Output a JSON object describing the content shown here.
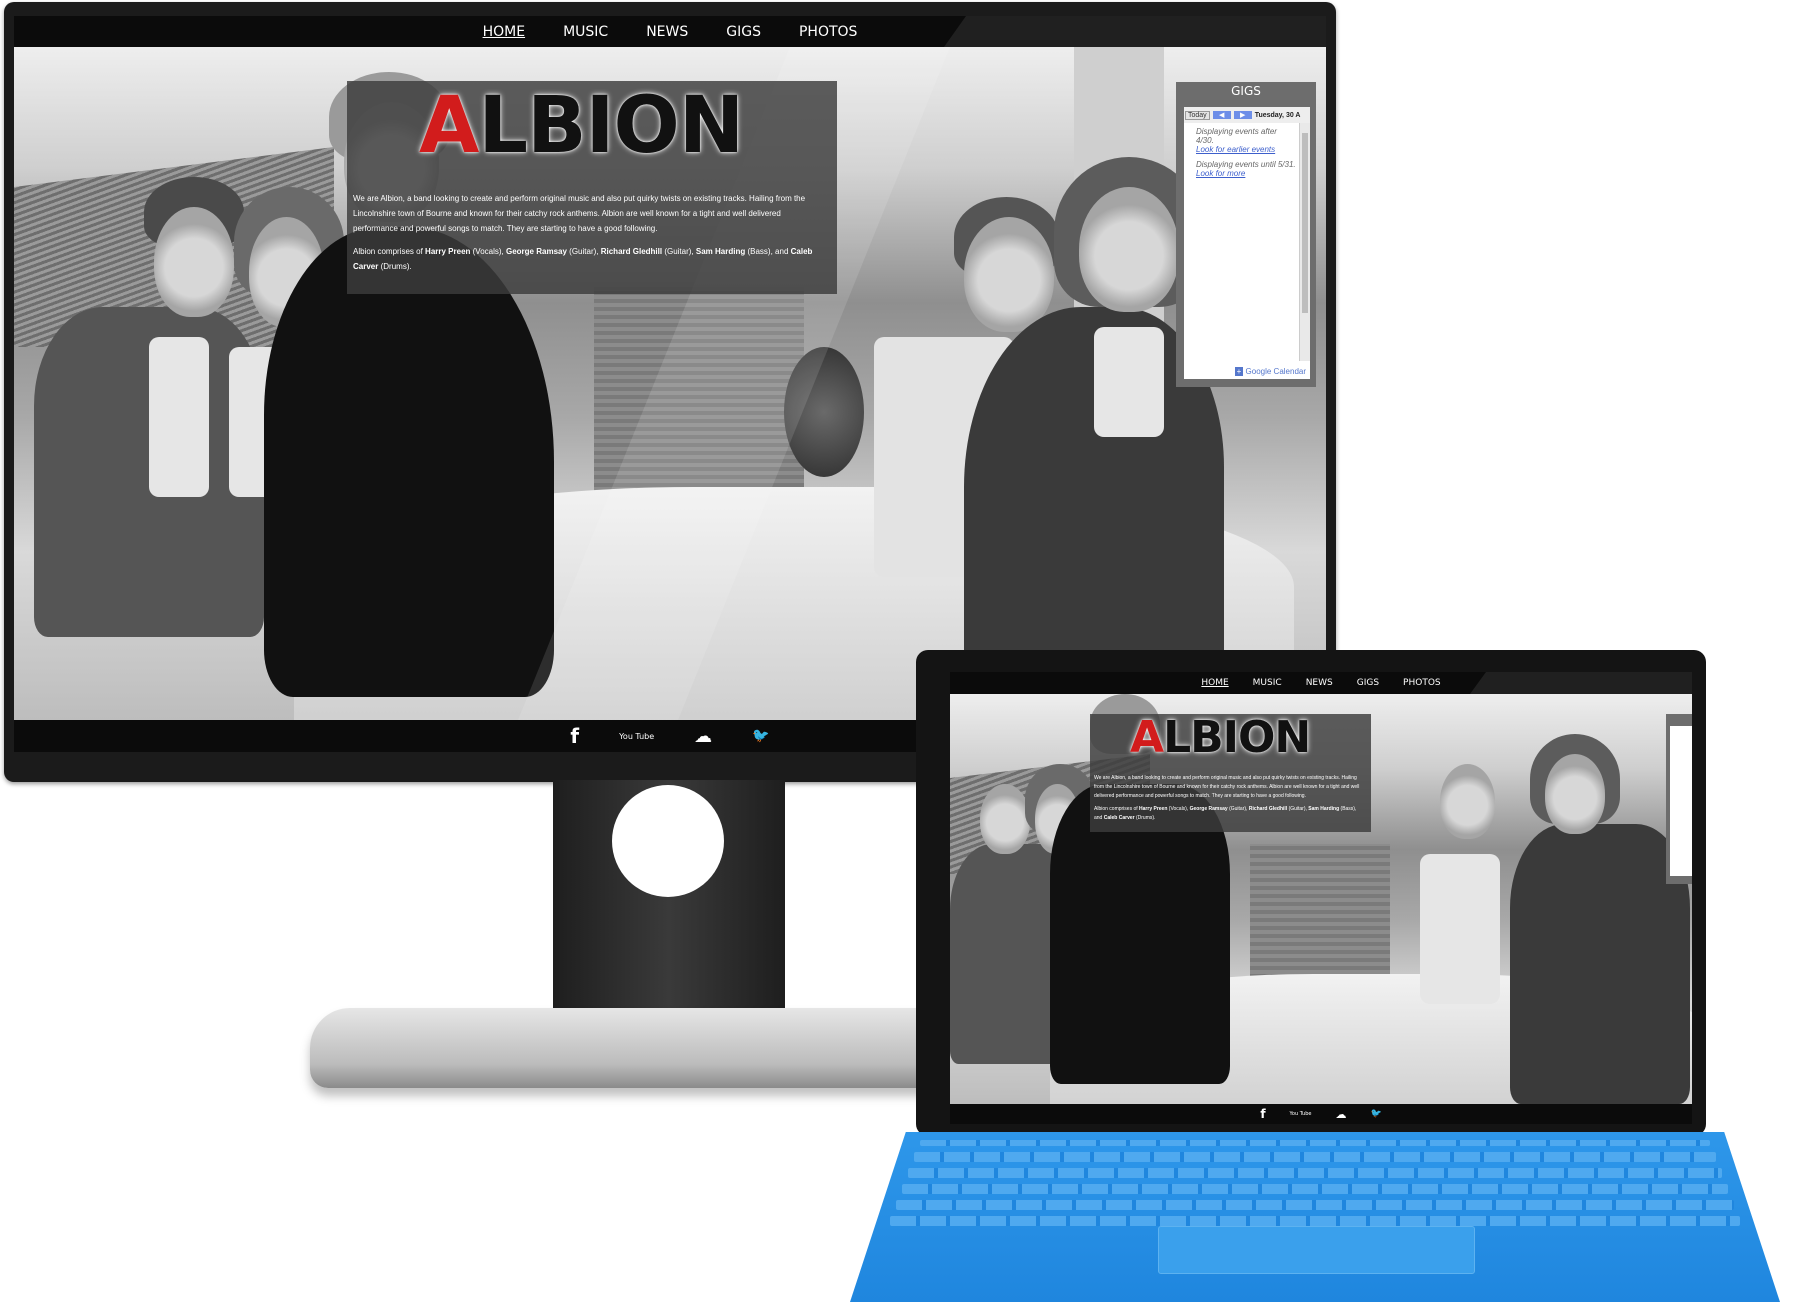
{
  "site": {
    "nav": [
      "HOME",
      "MUSIC",
      "NEWS",
      "GIGS",
      "PHOTOS"
    ],
    "active_nav": "HOME",
    "logo_text": "ALBION",
    "intro_paragraph": "We are Albion, a band looking to create and perform original music and also put quirky twists on existing tracks. Hailing from the Lincolnshire town of Bourne and known for their catchy rock anthems. Albion are well known for a tight and well delivered performance and powerful songs to match. They are starting to have a good following.",
    "members_intro": "Albion comprises of",
    "members": [
      {
        "name": "Harry Preen",
        "role": "(Vocals),"
      },
      {
        "name": "George Ramsay",
        "role": "(Guitar),"
      },
      {
        "name": "Richard Gledhill",
        "role": "(Guitar),"
      },
      {
        "name": "Sam Harding",
        "role": "(Bass),"
      },
      {
        "name": "Caleb Carver",
        "role": "(Drums)."
      }
    ],
    "members_and": "and",
    "gigs_title": "GIGS",
    "calendar": {
      "today_label": "Today",
      "prev_icon": "◀",
      "next_icon": "▶",
      "date_label": "Tuesday, 30 A",
      "msg1": "Displaying events after 4/30.",
      "link1": "Look for earlier events",
      "msg2": "Displaying events until 5/31.",
      "link2": "Look for more",
      "google_calendar_label": "Google Calendar",
      "plus_icon": "+"
    },
    "social": [
      "facebook-icon",
      "youtube-icon",
      "soundcloud-icon",
      "twitter-icon"
    ],
    "social_glyphs": {
      "facebook": "f",
      "youtube": "You Tube",
      "soundcloud": "☁",
      "twitter": "🐦"
    }
  },
  "colors": {
    "nav_bg": "#0b0b0b",
    "logo_red": "#d21c1c",
    "panel_gray": "#6d6d6d",
    "keyboard_blue": "#1f86de"
  }
}
